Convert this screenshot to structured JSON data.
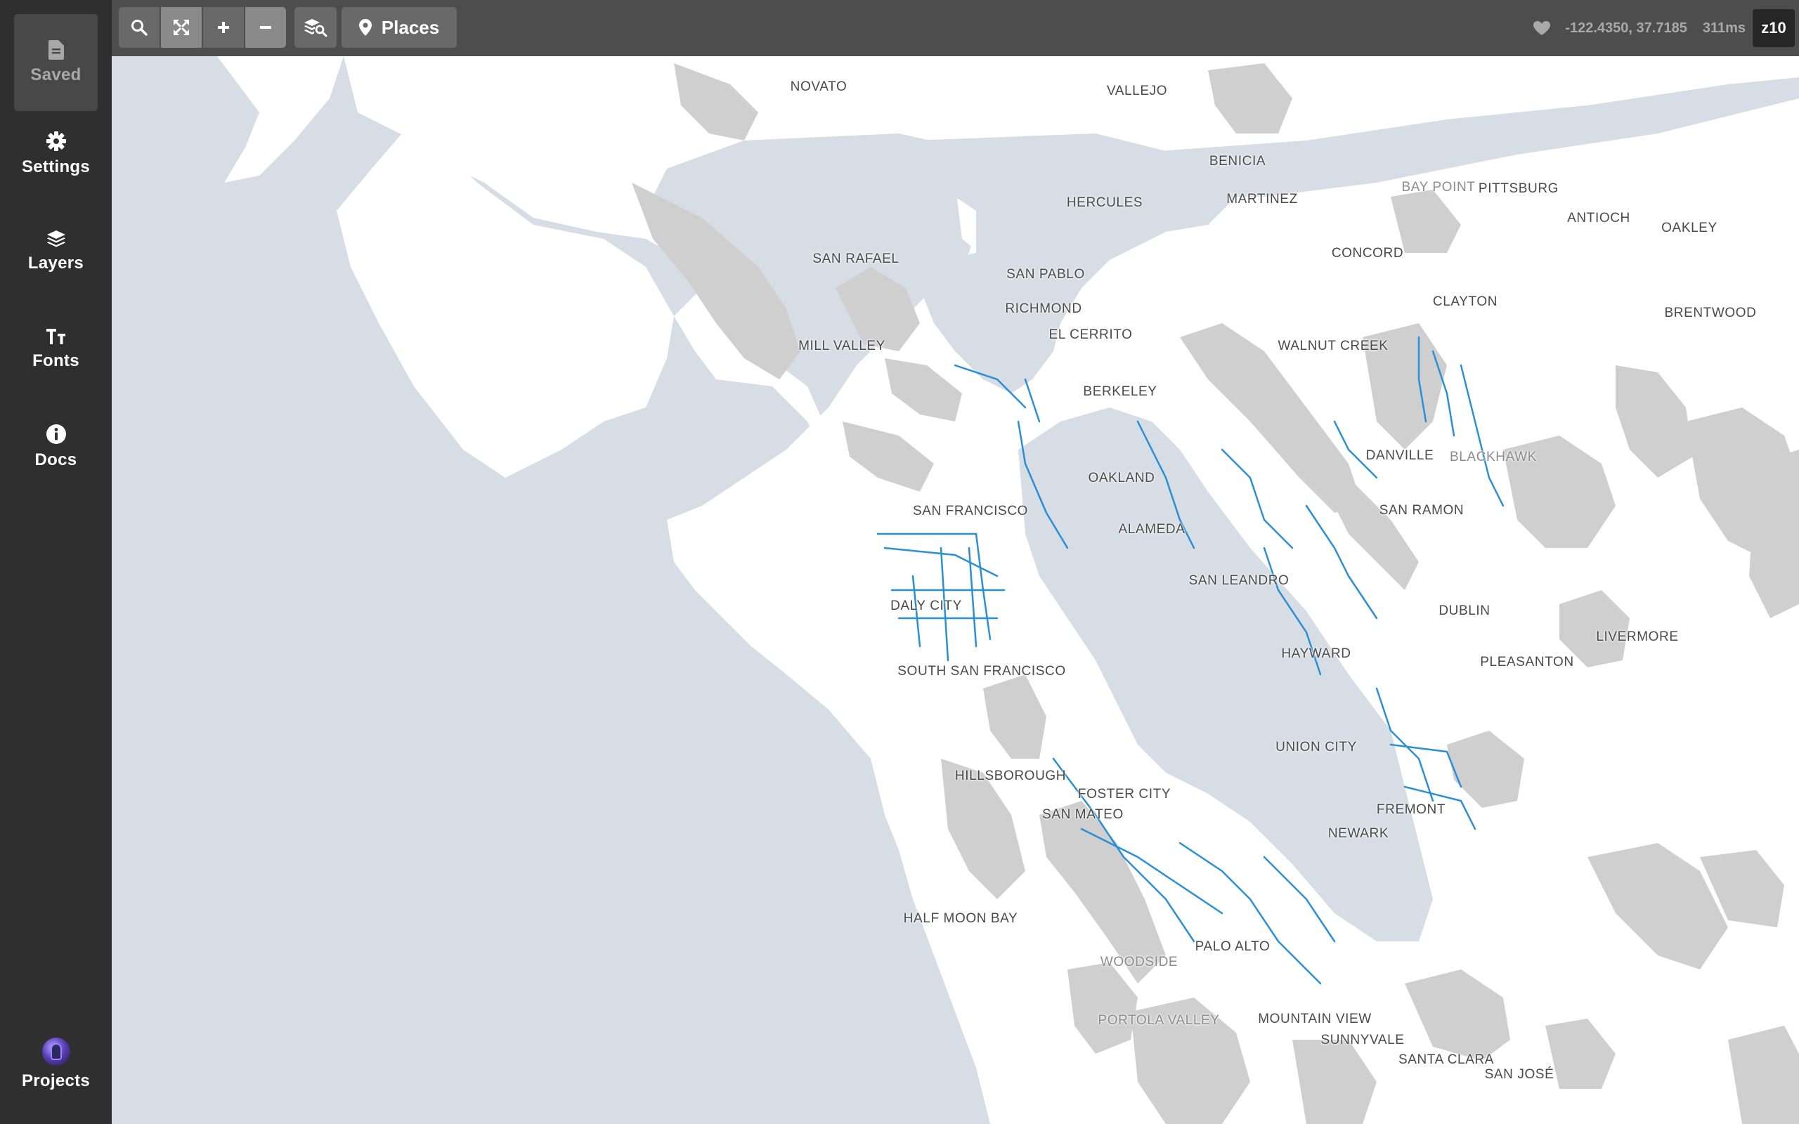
{
  "sidebar": {
    "saved": {
      "label": "Saved",
      "icon": "document-icon"
    },
    "settings": {
      "label": "Settings",
      "icon": "gear-icon"
    },
    "layers": {
      "label": "Layers",
      "icon": "layers-icon"
    },
    "fonts": {
      "label": "Fonts",
      "icon": "font-icon"
    },
    "docs": {
      "label": "Docs",
      "icon": "info-icon"
    },
    "projects": {
      "label": "Projects",
      "icon": "avatar"
    }
  },
  "toolbar": {
    "places_label": "Places",
    "coordinates": "-122.4350, 37.7185",
    "render_time": "311ms",
    "zoom_level": "z10"
  },
  "map": {
    "places": [
      {
        "name": "NOVATO"
      },
      {
        "name": "VALLEJO"
      },
      {
        "name": "BENICIA"
      },
      {
        "name": "HERCULES"
      },
      {
        "name": "MARTINEZ"
      },
      {
        "name": "BAY POINT"
      },
      {
        "name": "PITTSBURG"
      },
      {
        "name": "ANTIOCH"
      },
      {
        "name": "OAKLEY"
      },
      {
        "name": "CONCORD"
      },
      {
        "name": "SAN RAFAEL"
      },
      {
        "name": "SAN PABLO"
      },
      {
        "name": "CLAYTON"
      },
      {
        "name": "RICHMOND"
      },
      {
        "name": "BRENTWOOD"
      },
      {
        "name": "EL CERRITO"
      },
      {
        "name": "MILL VALLEY"
      },
      {
        "name": "WALNUT CREEK"
      },
      {
        "name": "BERKELEY"
      },
      {
        "name": "DANVILLE"
      },
      {
        "name": "BLACKHAWK"
      },
      {
        "name": "OAKLAND"
      },
      {
        "name": "SAN FRANCISCO"
      },
      {
        "name": "SAN RAMON"
      },
      {
        "name": "ALAMEDA"
      },
      {
        "name": "SAN LEANDRO"
      },
      {
        "name": "DALY CITY"
      },
      {
        "name": "DUBLIN"
      },
      {
        "name": "LIVERMORE"
      },
      {
        "name": "HAYWARD"
      },
      {
        "name": "PLEASANTON"
      },
      {
        "name": "SOUTH SAN FRANCISCO"
      },
      {
        "name": "UNION CITY"
      },
      {
        "name": "HILLSBOROUGH"
      },
      {
        "name": "FOSTER CITY"
      },
      {
        "name": "FREMONT"
      },
      {
        "name": "SAN MATEO"
      },
      {
        "name": "NEWARK"
      },
      {
        "name": "HALF MOON BAY"
      },
      {
        "name": "PALO ALTO"
      },
      {
        "name": "WOODSIDE"
      },
      {
        "name": "PORTOLA VALLEY"
      },
      {
        "name": "MOUNTAIN VIEW"
      },
      {
        "name": "SUNNYVALE"
      },
      {
        "name": "SANTA CLARA"
      },
      {
        "name": "SAN JOSÉ"
      }
    ]
  },
  "colors": {
    "water": "#d6dde4",
    "land": "#ffffff",
    "parks": "#cfcfcf",
    "bike_routes": "#2b8fd6",
    "sidebar": "#2f2f2f",
    "toolbar": "#4d4d4d"
  }
}
